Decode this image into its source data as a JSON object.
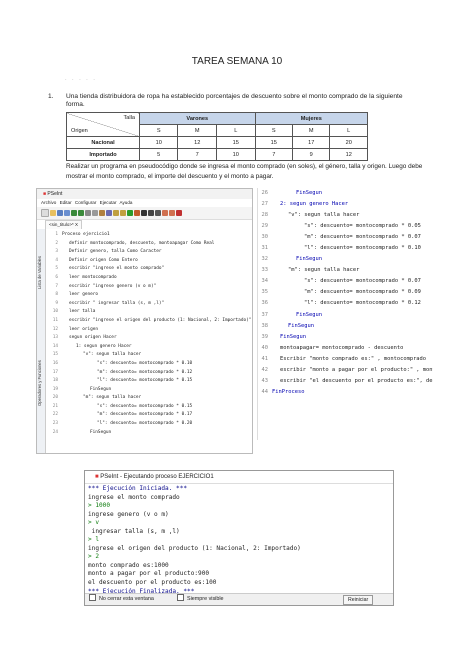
{
  "title": "TAREA SEMANA 10",
  "question": {
    "number": "1.",
    "text": "Una tienda distribuidora de ropa ha establecido porcentajes de descuento sobre el monto comprado de la siguiente forma."
  },
  "table": {
    "corner_top": "Talla",
    "corner_bottom": "Origen",
    "groups": [
      "Varones",
      "Mujeres"
    ],
    "sizes": [
      "S",
      "M",
      "L",
      "S",
      "M",
      "L"
    ],
    "rows": [
      {
        "label": "Nacional",
        "values": [
          "10",
          "12",
          "15",
          "15",
          "17",
          "20"
        ]
      },
      {
        "label": "Importado",
        "values": [
          "5",
          "7",
          "10",
          "7",
          "9",
          "12"
        ]
      }
    ]
  },
  "paragraph": "Realizar un programa en pseudocódigo donde se ingresa el monto comprado (en soles), el género, talla y origen. Luego debe mostrar el monto comprado, el importe del descuento y el monto a pagar.",
  "ide": {
    "title": "PSeInt",
    "menu": [
      "Archivo",
      "Editar",
      "Configurar",
      "Ejecutar",
      "Ayuda"
    ],
    "tab": "<sin_titulo>*  X",
    "side_labels": [
      "Lista de Variables",
      "Operadores y Funciones"
    ],
    "code": [
      "Proceso ejercicio1",
      "definir montocomprado, descuento, montoapagar Como Real",
      "Definir  genero, talla Como Caracter",
      "Definir origen Como Entero",
      "escribir \"ingrese el monto comprado\"",
      "leer montocomprado",
      "escribir \"ingrese genero (v o m)\"",
      "leer genero",
      "escribir \" ingresar talla (s, m ,l)\"",
      "leer talla",
      "escribir \"ingrese el origen del producto (1: Nacional, 2: Importado)\"",
      "leer origen",
      "segun origen Hacer",
      "1: segun genero Hacer",
      "\"v\": segun talla hacer",
      "\"s\": descuento= montocomprado * 0.10",
      "\"m\": descuento= montocomprado * 0.12",
      "\"l\": descuento= montocomprado * 0.15",
      "FinSegun",
      "\"m\": segun talla hacer",
      "\"s\": descuento= montocomprado * 0.15",
      "\"m\": descuento= montocomprado * 0.17",
      "\"l\": descuento= montocomprado * 0.20",
      "FinSegun"
    ]
  },
  "right_code": [
    {
      "n": "26",
      "t": "FinSegun"
    },
    {
      "n": "27",
      "t": "2: segun genero Hacer"
    },
    {
      "n": "28",
      "t": "\"v\": segun talla hacer"
    },
    {
      "n": "29",
      "t": "\"s\": descuento= montocomprado * 0.05"
    },
    {
      "n": "30",
      "t": "\"m\": descuento= montocomprado * 0.07"
    },
    {
      "n": "31",
      "t": "\"l\": descuento= montocomprado * 0.10"
    },
    {
      "n": "32",
      "t": "FinSegun"
    },
    {
      "n": "33",
      "t": "\"m\": segun talla hacer"
    },
    {
      "n": "34",
      "t": "\"s\": descuento= montocomprado * 0.07"
    },
    {
      "n": "35",
      "t": "\"m\": descuento= montocomprado * 0.09"
    },
    {
      "n": "36",
      "t": "\"l\": descuento= montocomprado * 0.12"
    },
    {
      "n": "37",
      "t": "FinSegun"
    },
    {
      "n": "38",
      "t": "FinSegun"
    },
    {
      "n": "39",
      "t": "FinSegun"
    },
    {
      "n": "40",
      "t": "montoapagar= montocomprado - descuento"
    },
    {
      "n": "41",
      "t": "Escribir \"monto comprado es:\" , montocomprado"
    },
    {
      "n": "42",
      "t": "escribir \"monto a pagar por el producto:\" , montoapagar"
    },
    {
      "n": "43",
      "t": "escribir \"el descuento por el producto es:\", descuento"
    },
    {
      "n": "44",
      "t": "FinProceso"
    }
  ],
  "console": {
    "title": "PSeInt - Ejecutando proceso EJERCICIO1",
    "lines": [
      "*** Ejecución Iniciada. ***",
      "ingrese el monto comprado",
      "> 1000",
      "ingrese genero (v o m)",
      "> v",
      " ingresar talla (s, m ,l)",
      "> l",
      "ingrese el origen del producto (1: Nacional, 2: Importado)",
      "> 2",
      "monto comprado es:1000",
      "monto a pagar por el producto:900",
      "el descuento por el producto es:100",
      "*** Ejecución Finalizada. ***"
    ],
    "checkbox_close": "No cerrar esta ventana",
    "checkbox_visible": "Siempre visible",
    "restart_button": "Reiniciar"
  }
}
